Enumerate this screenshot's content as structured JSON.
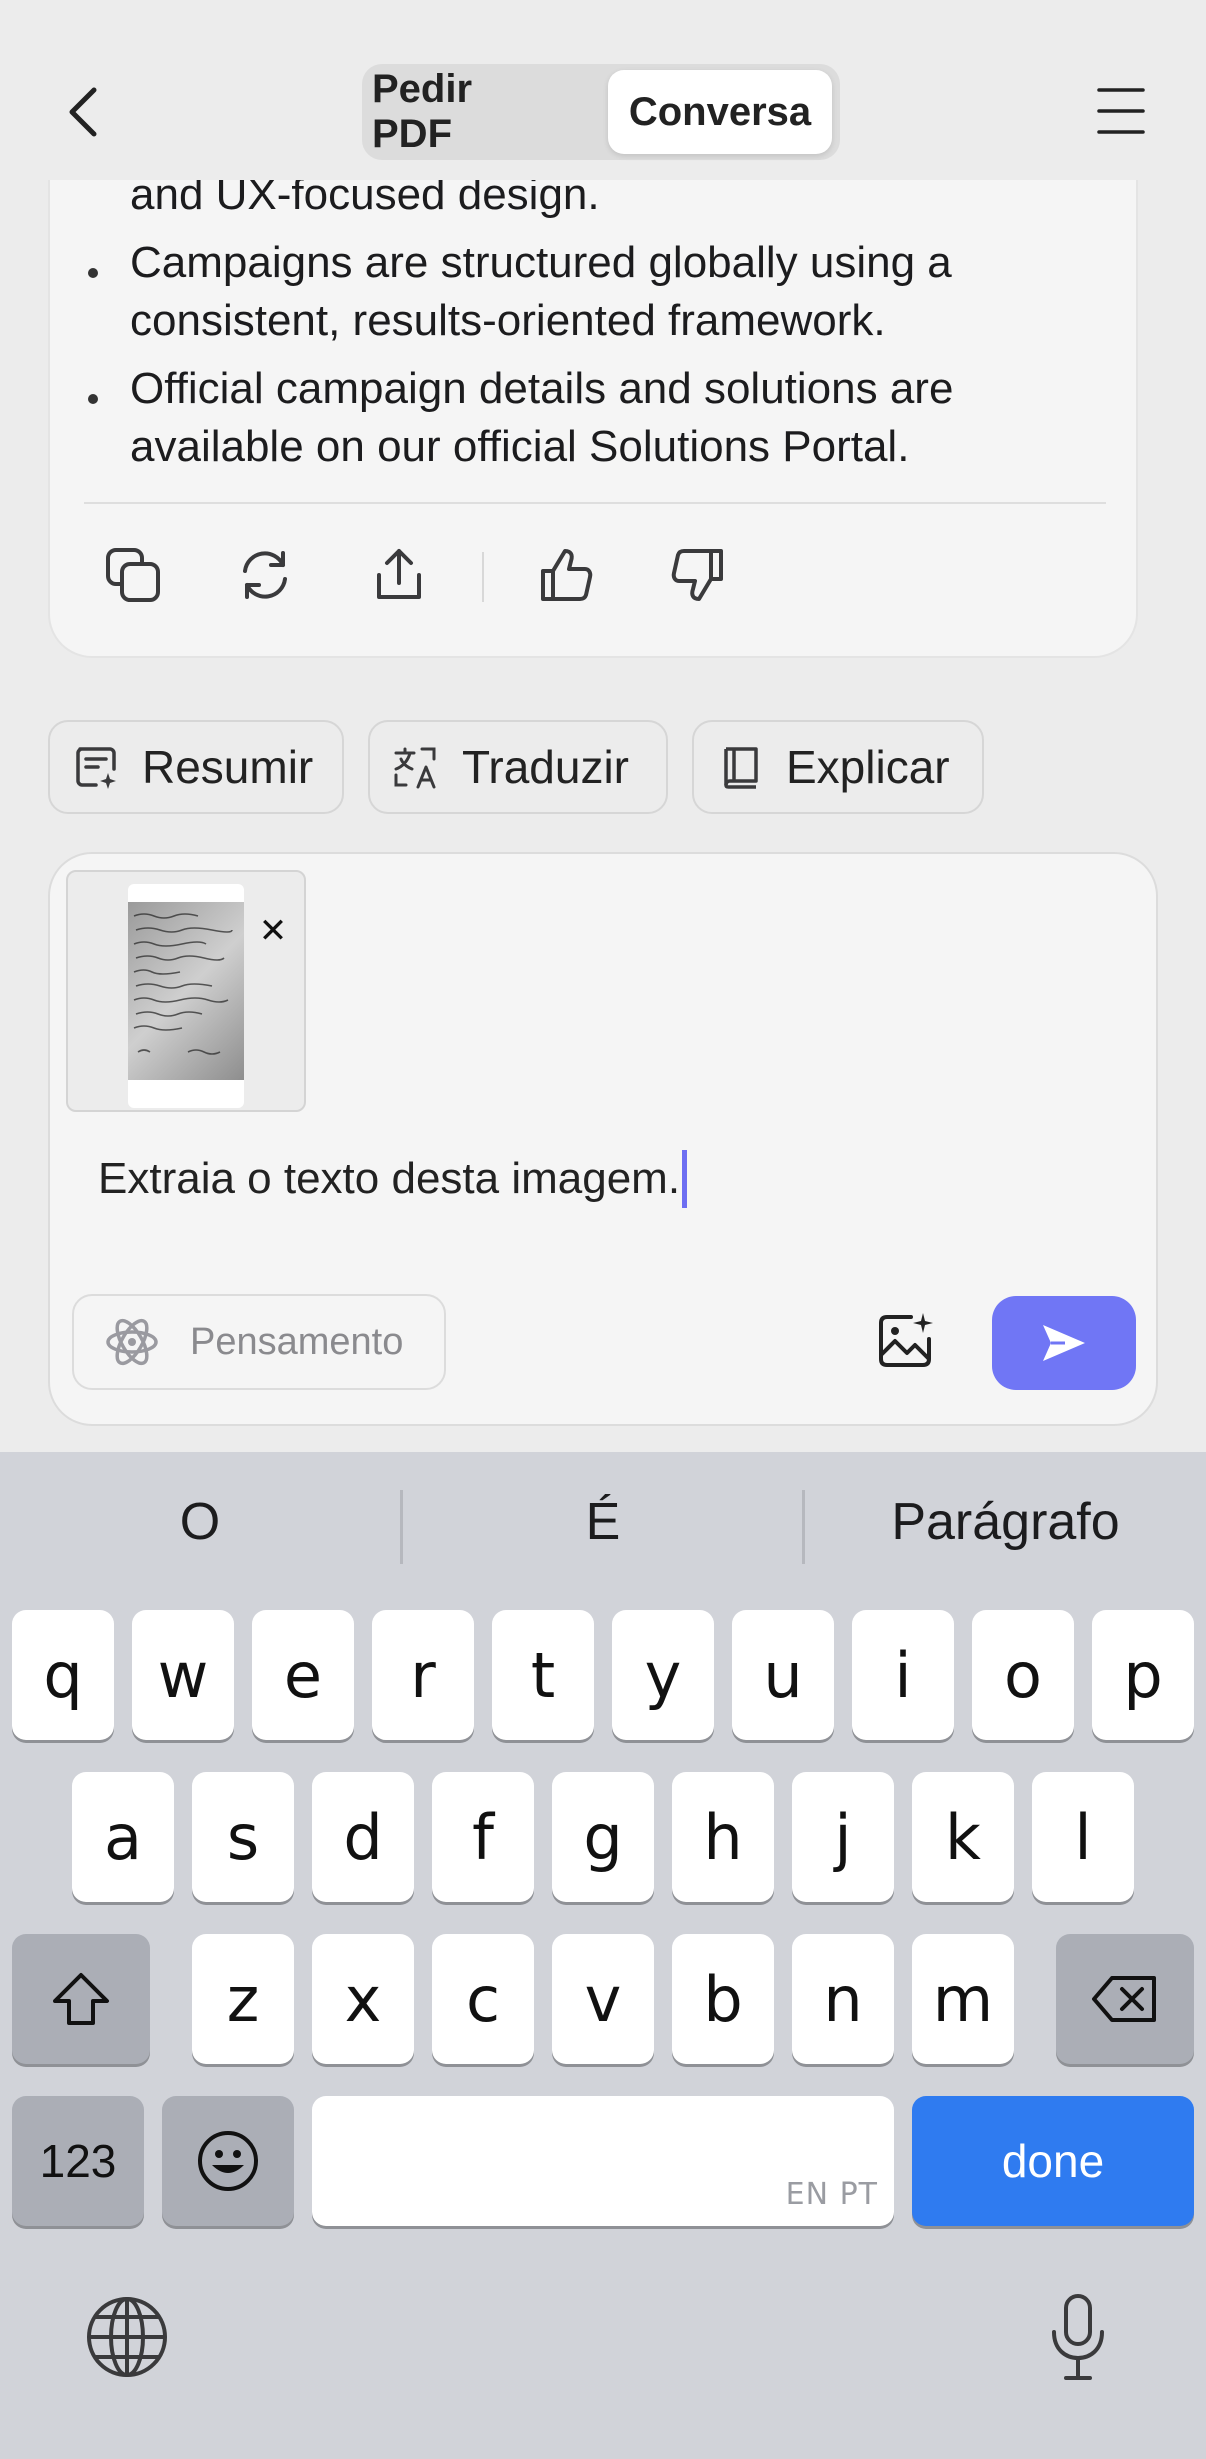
{
  "header": {
    "tabs": [
      {
        "label": "Pedir PDF",
        "active": false
      },
      {
        "label": "Conversa",
        "active": true
      }
    ]
  },
  "message": {
    "lines": [
      "and UX-focused design.",
      "Campaigns are structured globally using a",
      "consistent, results-oriented framework.",
      "Official campaign details and solutions are",
      "available on our official Solutions Portal."
    ],
    "actions": [
      "copy-icon",
      "regenerate-icon",
      "share-icon",
      "thumbs-up-icon",
      "thumbs-down-icon"
    ]
  },
  "quick_actions": [
    {
      "label": "Resumir",
      "icon": "summarize-icon"
    },
    {
      "label": "Traduzir",
      "icon": "translate-icon"
    },
    {
      "label": "Explicar",
      "icon": "book-icon"
    }
  ],
  "composer": {
    "text": "Extraia o texto desta imagem.",
    "thinking_label": "Pensamento",
    "attachment": "image-thumbnail",
    "accent_color": "#7076f5"
  },
  "keyboard": {
    "suggestions": [
      "O",
      "É",
      "Parágrafo"
    ],
    "row1": [
      "q",
      "w",
      "e",
      "r",
      "t",
      "y",
      "u",
      "i",
      "o",
      "p"
    ],
    "row2": [
      "a",
      "s",
      "d",
      "f",
      "g",
      "h",
      "j",
      "k",
      "l"
    ],
    "row3": [
      "z",
      "x",
      "c",
      "v",
      "b",
      "n",
      "m"
    ],
    "numbers_label": "123",
    "space_tag": "EN PT",
    "done_label": "done",
    "done_color": "#2f7bf0"
  }
}
